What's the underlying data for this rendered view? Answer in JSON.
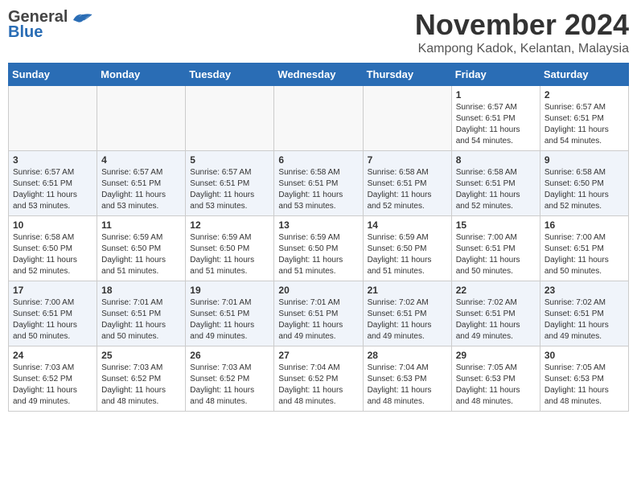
{
  "header": {
    "logo_general": "General",
    "logo_blue": "Blue",
    "month_year": "November 2024",
    "location": "Kampong Kadok, Kelantan, Malaysia"
  },
  "weekdays": [
    "Sunday",
    "Monday",
    "Tuesday",
    "Wednesday",
    "Thursday",
    "Friday",
    "Saturday"
  ],
  "weeks": [
    [
      {
        "day": "",
        "info": ""
      },
      {
        "day": "",
        "info": ""
      },
      {
        "day": "",
        "info": ""
      },
      {
        "day": "",
        "info": ""
      },
      {
        "day": "",
        "info": ""
      },
      {
        "day": "1",
        "info": "Sunrise: 6:57 AM\nSunset: 6:51 PM\nDaylight: 11 hours and 54 minutes."
      },
      {
        "day": "2",
        "info": "Sunrise: 6:57 AM\nSunset: 6:51 PM\nDaylight: 11 hours and 54 minutes."
      }
    ],
    [
      {
        "day": "3",
        "info": "Sunrise: 6:57 AM\nSunset: 6:51 PM\nDaylight: 11 hours and 53 minutes."
      },
      {
        "day": "4",
        "info": "Sunrise: 6:57 AM\nSunset: 6:51 PM\nDaylight: 11 hours and 53 minutes."
      },
      {
        "day": "5",
        "info": "Sunrise: 6:57 AM\nSunset: 6:51 PM\nDaylight: 11 hours and 53 minutes."
      },
      {
        "day": "6",
        "info": "Sunrise: 6:58 AM\nSunset: 6:51 PM\nDaylight: 11 hours and 53 minutes."
      },
      {
        "day": "7",
        "info": "Sunrise: 6:58 AM\nSunset: 6:51 PM\nDaylight: 11 hours and 52 minutes."
      },
      {
        "day": "8",
        "info": "Sunrise: 6:58 AM\nSunset: 6:51 PM\nDaylight: 11 hours and 52 minutes."
      },
      {
        "day": "9",
        "info": "Sunrise: 6:58 AM\nSunset: 6:50 PM\nDaylight: 11 hours and 52 minutes."
      }
    ],
    [
      {
        "day": "10",
        "info": "Sunrise: 6:58 AM\nSunset: 6:50 PM\nDaylight: 11 hours and 52 minutes."
      },
      {
        "day": "11",
        "info": "Sunrise: 6:59 AM\nSunset: 6:50 PM\nDaylight: 11 hours and 51 minutes."
      },
      {
        "day": "12",
        "info": "Sunrise: 6:59 AM\nSunset: 6:50 PM\nDaylight: 11 hours and 51 minutes."
      },
      {
        "day": "13",
        "info": "Sunrise: 6:59 AM\nSunset: 6:50 PM\nDaylight: 11 hours and 51 minutes."
      },
      {
        "day": "14",
        "info": "Sunrise: 6:59 AM\nSunset: 6:50 PM\nDaylight: 11 hours and 51 minutes."
      },
      {
        "day": "15",
        "info": "Sunrise: 7:00 AM\nSunset: 6:51 PM\nDaylight: 11 hours and 50 minutes."
      },
      {
        "day": "16",
        "info": "Sunrise: 7:00 AM\nSunset: 6:51 PM\nDaylight: 11 hours and 50 minutes."
      }
    ],
    [
      {
        "day": "17",
        "info": "Sunrise: 7:00 AM\nSunset: 6:51 PM\nDaylight: 11 hours and 50 minutes."
      },
      {
        "day": "18",
        "info": "Sunrise: 7:01 AM\nSunset: 6:51 PM\nDaylight: 11 hours and 50 minutes."
      },
      {
        "day": "19",
        "info": "Sunrise: 7:01 AM\nSunset: 6:51 PM\nDaylight: 11 hours and 49 minutes."
      },
      {
        "day": "20",
        "info": "Sunrise: 7:01 AM\nSunset: 6:51 PM\nDaylight: 11 hours and 49 minutes."
      },
      {
        "day": "21",
        "info": "Sunrise: 7:02 AM\nSunset: 6:51 PM\nDaylight: 11 hours and 49 minutes."
      },
      {
        "day": "22",
        "info": "Sunrise: 7:02 AM\nSunset: 6:51 PM\nDaylight: 11 hours and 49 minutes."
      },
      {
        "day": "23",
        "info": "Sunrise: 7:02 AM\nSunset: 6:51 PM\nDaylight: 11 hours and 49 minutes."
      }
    ],
    [
      {
        "day": "24",
        "info": "Sunrise: 7:03 AM\nSunset: 6:52 PM\nDaylight: 11 hours and 49 minutes."
      },
      {
        "day": "25",
        "info": "Sunrise: 7:03 AM\nSunset: 6:52 PM\nDaylight: 11 hours and 48 minutes."
      },
      {
        "day": "26",
        "info": "Sunrise: 7:03 AM\nSunset: 6:52 PM\nDaylight: 11 hours and 48 minutes."
      },
      {
        "day": "27",
        "info": "Sunrise: 7:04 AM\nSunset: 6:52 PM\nDaylight: 11 hours and 48 minutes."
      },
      {
        "day": "28",
        "info": "Sunrise: 7:04 AM\nSunset: 6:53 PM\nDaylight: 11 hours and 48 minutes."
      },
      {
        "day": "29",
        "info": "Sunrise: 7:05 AM\nSunset: 6:53 PM\nDaylight: 11 hours and 48 minutes."
      },
      {
        "day": "30",
        "info": "Sunrise: 7:05 AM\nSunset: 6:53 PM\nDaylight: 11 hours and 48 minutes."
      }
    ]
  ]
}
